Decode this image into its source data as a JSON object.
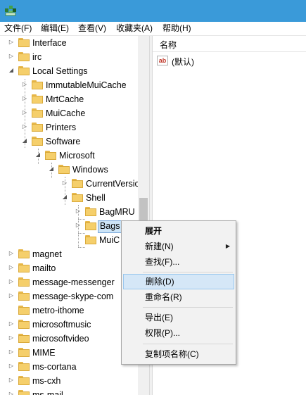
{
  "menubar": {
    "file": "文件(F)",
    "edit": "编辑(E)",
    "view": "查看(V)",
    "favorites": "收藏夹(A)",
    "help": "帮助(H)"
  },
  "tree": {
    "items": [
      {
        "label": "Interface",
        "expander": "collapsed"
      },
      {
        "label": "irc",
        "expander": "collapsed"
      },
      {
        "label": "Local Settings",
        "expander": "expanded"
      },
      {
        "label": "ImmutableMuiCache",
        "expander": "collapsed"
      },
      {
        "label": "MrtCache",
        "expander": "collapsed"
      },
      {
        "label": "MuiCache",
        "expander": "collapsed"
      },
      {
        "label": "Printers",
        "expander": "collapsed"
      },
      {
        "label": "Software",
        "expander": "expanded"
      },
      {
        "label": "Microsoft",
        "expander": "expanded"
      },
      {
        "label": "Windows",
        "expander": "expanded"
      },
      {
        "label": "CurrentVersio",
        "expander": "collapsed"
      },
      {
        "label": "Shell",
        "expander": "expanded"
      },
      {
        "label": "BagMRU",
        "expander": "collapsed"
      },
      {
        "label": "Bags",
        "expander": "collapsed",
        "selected": true
      },
      {
        "label": "MuiC",
        "expander": "none"
      },
      {
        "label": "magnet",
        "expander": "collapsed"
      },
      {
        "label": "mailto",
        "expander": "collapsed"
      },
      {
        "label": "message-messenger",
        "expander": "collapsed"
      },
      {
        "label": "message-skype-com",
        "expander": "collapsed"
      },
      {
        "label": "metro-ithome",
        "expander": "collapsed"
      },
      {
        "label": "microsoftmusic",
        "expander": "collapsed"
      },
      {
        "label": "microsoftvideo",
        "expander": "collapsed"
      },
      {
        "label": "MIME",
        "expander": "collapsed"
      },
      {
        "label": "ms-cortana",
        "expander": "collapsed"
      },
      {
        "label": "ms-cxh",
        "expander": "collapsed"
      },
      {
        "label": "ms-mail",
        "expander": "collapsed"
      }
    ]
  },
  "values_pane": {
    "column_name": "名称",
    "rows": [
      {
        "icon": "string-value-icon",
        "icon_text": "ab",
        "name": "(默认)"
      }
    ]
  },
  "context_menu": {
    "items": [
      {
        "label": "展开",
        "bold": true
      },
      {
        "label": "新建(N)",
        "submenu": true
      },
      {
        "label": "查找(F)..."
      },
      {
        "label": "删除(D)",
        "highlighted": true
      },
      {
        "label": "重命名(R)"
      },
      {
        "label": "导出(E)"
      },
      {
        "label": "权限(P)..."
      },
      {
        "label": "复制项名称(C)"
      }
    ]
  },
  "colors": {
    "titlebar": "#3a9ad9",
    "selection": "#cce4f7",
    "menu_highlight": "#d5e7f7"
  }
}
